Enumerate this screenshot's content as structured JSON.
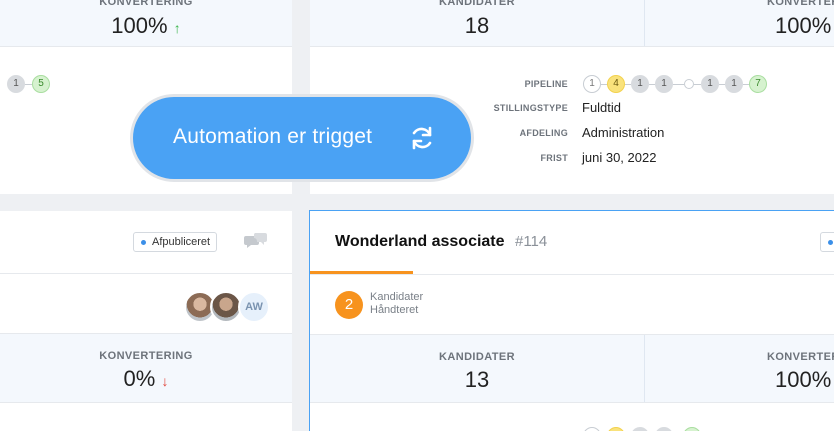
{
  "top_left_card": {
    "metric_label": "KONVERTERING",
    "metric_value": "100%",
    "pipeline_partial": [
      "1",
      "5"
    ]
  },
  "top_right_card": {
    "metrics": [
      {
        "label": "KANDIDATER",
        "value": "18"
      },
      {
        "label": "KONVERTERING",
        "value": "100%"
      }
    ],
    "details": {
      "pipeline_label": "PIPELINE",
      "pipeline_steps": [
        "1",
        "4",
        "1",
        "1",
        "",
        "1",
        "1",
        "7"
      ],
      "stillingstype_label": "STILLINGSTYPE",
      "stillingstype_value": "Fuldtid",
      "afdeling_label": "AFDELING",
      "afdeling_value": "Administration",
      "frist_label": "FRIST",
      "frist_value": "juni 30, 2022"
    }
  },
  "automation_toast": {
    "label": "Automation er trigget",
    "icon": "refresh-icon"
  },
  "bottom_left_card": {
    "status_badge": "Afpubliceret",
    "avatar_initials": "AW",
    "metric_label": "KONVERTERING",
    "metric_value": "0%"
  },
  "bottom_right_card": {
    "title": "Wonderland associate",
    "id": "#114",
    "status_badge": "",
    "handled_count": "2",
    "candidates_label": "Kandidater",
    "handled_label": "Håndteret",
    "metrics": [
      {
        "label": "KANDIDATER",
        "value": "13"
      },
      {
        "label": "KONVERTERING",
        "value": "100%"
      }
    ]
  },
  "colors": {
    "accent_blue": "#4aa2f4",
    "orange": "#f7931e",
    "green_arrow": "#3ab54a",
    "red_arrow": "#e0453a"
  }
}
